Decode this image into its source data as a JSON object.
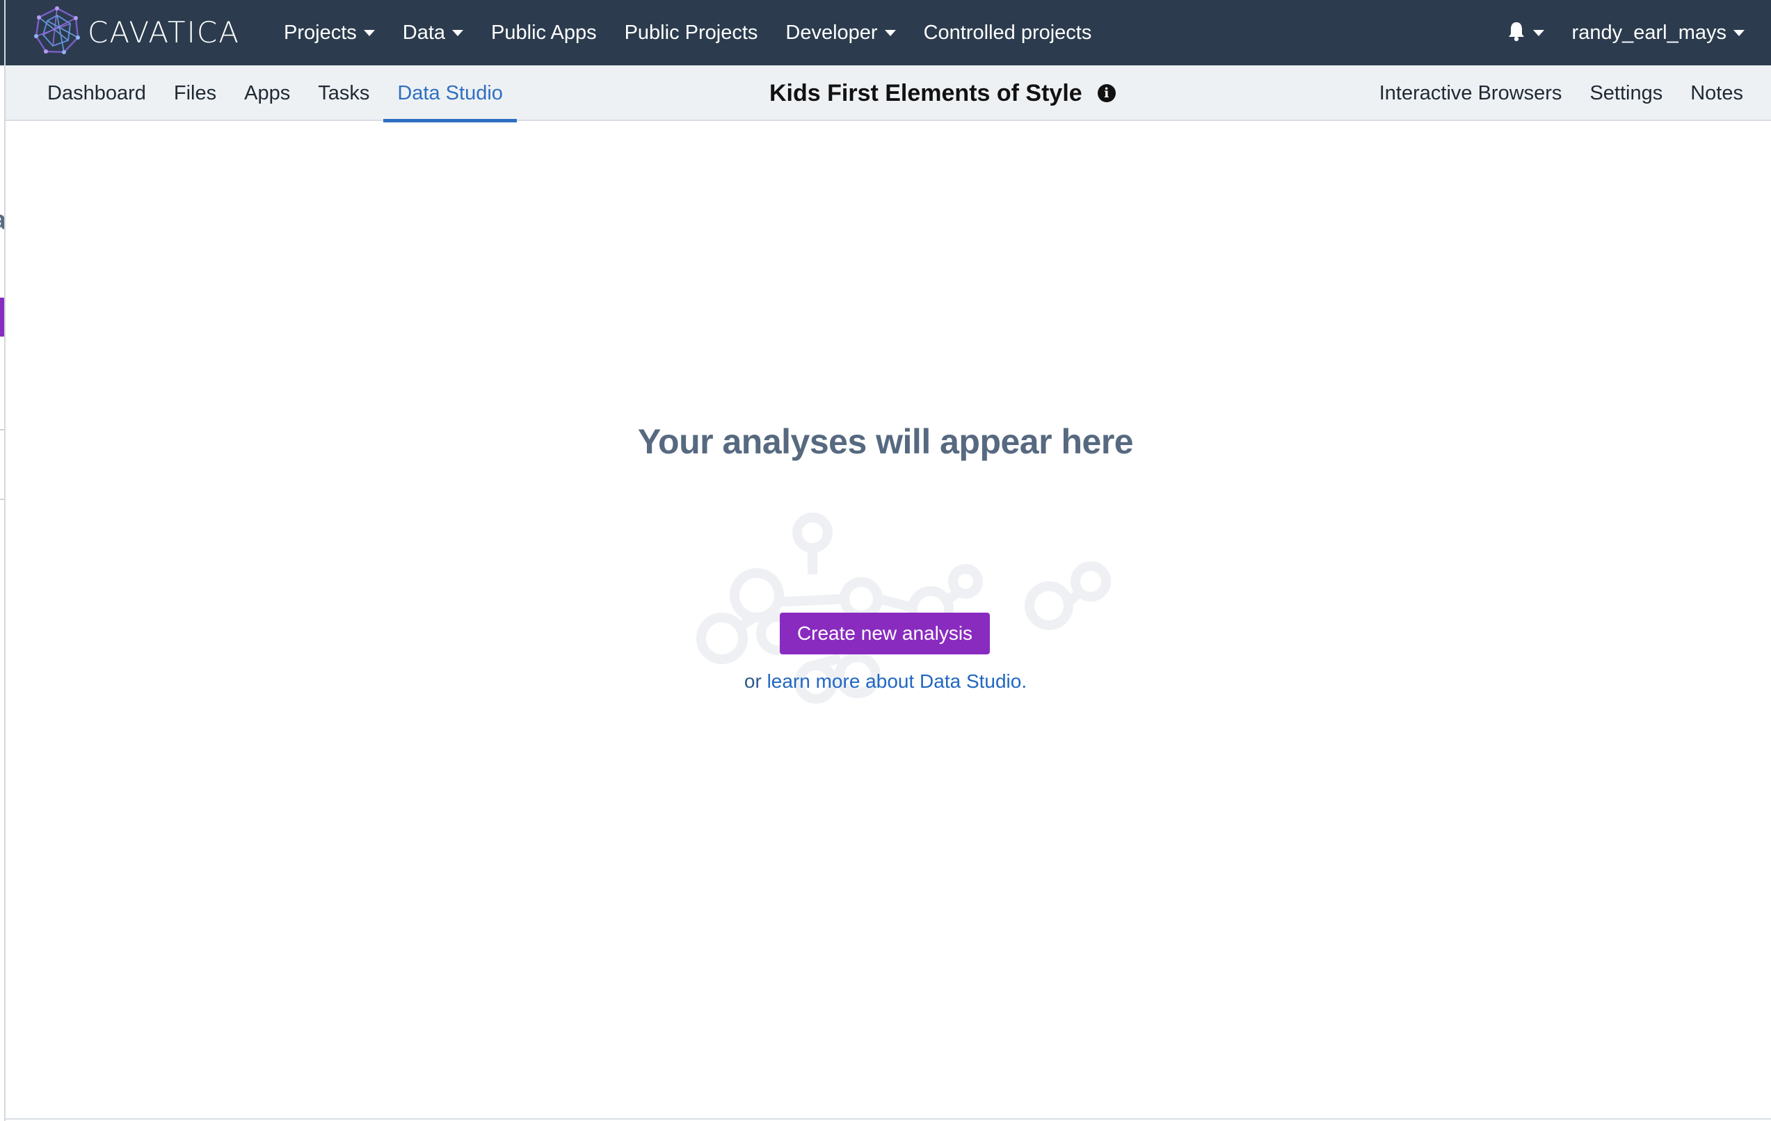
{
  "navbar": {
    "brand": "CAVATICA",
    "items": [
      {
        "label": "Projects",
        "dropdown": true
      },
      {
        "label": "Data",
        "dropdown": true
      },
      {
        "label": "Public Apps",
        "dropdown": false
      },
      {
        "label": "Public Projects",
        "dropdown": false
      },
      {
        "label": "Developer",
        "dropdown": true
      },
      {
        "label": "Controlled projects",
        "dropdown": false
      }
    ],
    "notifications_icon": "bell-icon",
    "username": "randy_earl_mays"
  },
  "project_nav": {
    "tabs": [
      "Dashboard",
      "Files",
      "Apps",
      "Tasks",
      "Data Studio"
    ],
    "active_tab": "Data Studio",
    "project_title": "Kids First Elements of Style",
    "info_icon": "info-icon",
    "right_links": [
      "Interactive Browsers",
      "Settings",
      "Notes"
    ]
  },
  "empty_state": {
    "title": "Your analyses will appear here",
    "create_button": "Create new analysis",
    "learn_prefix": "or",
    "learn_link": "learn more about Data Studio",
    "learn_suffix": "."
  },
  "colors": {
    "navbar_bg": "#2c3c4e",
    "subnav_bg": "#eef1f4",
    "accent_purple": "#8a2bc0",
    "active_tab_blue": "#2f6fc2",
    "link_blue": "#2167c2",
    "empty_title": "#566980"
  }
}
